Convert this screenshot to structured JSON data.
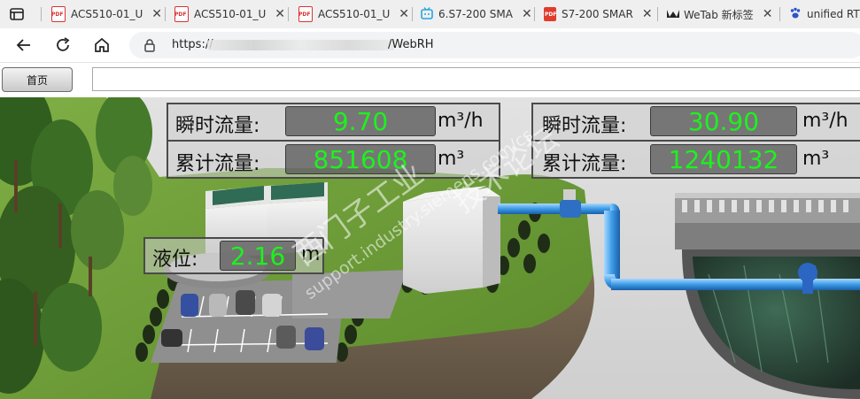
{
  "browser": {
    "tabs": [
      {
        "label": "ACS510-01_U",
        "icon": "pdf-icon"
      },
      {
        "label": "ACS510-01_U",
        "icon": "pdf-icon"
      },
      {
        "label": "ACS510-01_U",
        "icon": "pdf-icon"
      },
      {
        "label": "6.S7-200 SMA",
        "icon": "bilibili-icon"
      },
      {
        "label": "S7-200 SMAR",
        "icon": "pdf-red-icon"
      },
      {
        "label": "WeTab 新标签",
        "icon": "crown-icon"
      },
      {
        "label": "unified RT",
        "icon": "paw-icon"
      }
    ],
    "url_prefix": "https://",
    "url_path": "/WebRH"
  },
  "toolbar": {
    "home_label": "首页",
    "field_value": ""
  },
  "panels": {
    "left": {
      "instant_label": "瞬时流量:",
      "instant_value": "9.70",
      "instant_unit": "m³/h",
      "total_label": "累计流量:",
      "total_value": "851608",
      "total_unit": "m³"
    },
    "right": {
      "instant_label": "瞬时流量:",
      "instant_value": "30.90",
      "instant_unit": "m³/h",
      "total_label": "累计流量:",
      "total_value": "1240132",
      "total_unit": "m³"
    },
    "level": {
      "label": "液位:",
      "value": "2.16",
      "unit": "m"
    }
  },
  "watermark": {
    "line1": "西门子工业",
    "line2": "技术论坛",
    "line3": "support.industry.siemens.com/cs"
  },
  "colors": {
    "value_green": "#1df21d",
    "pipe_blue": "#3c9be6"
  }
}
